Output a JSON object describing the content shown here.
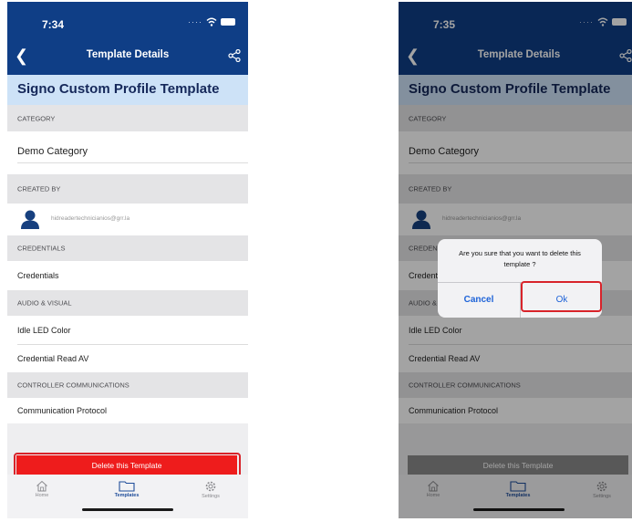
{
  "left": {
    "status": {
      "time": "7:34"
    },
    "nav": {
      "title": "Template Details"
    },
    "header": {
      "title": "Signo Custom Profile Template"
    },
    "sections": {
      "category": {
        "label": "CATEGORY",
        "value": "Demo Category"
      },
      "created_by": {
        "label": "CREATED BY",
        "email": "hidreadertechnicianios@grr.la"
      },
      "credentials": {
        "label": "CREDENTIALS",
        "item": "Credentials"
      },
      "audio_visual": {
        "label": "AUDIO & VISUAL",
        "items": [
          "Idle LED Color",
          "Credential Read AV"
        ]
      },
      "controller": {
        "label": "CONTROLLER COMMUNICATIONS",
        "item": "Communication Protocol"
      }
    },
    "delete_button": {
      "label": "Delete this Template",
      "color": "#ee1c1c"
    },
    "tabs": [
      {
        "label": "Home",
        "icon": "home-icon"
      },
      {
        "label": "Templates",
        "icon": "folder-icon"
      },
      {
        "label": "Settings",
        "icon": "gear-icon"
      }
    ]
  },
  "right": {
    "status": {
      "time": "7:35"
    },
    "nav": {
      "title": "Template Details"
    },
    "header": {
      "title": "Signo Custom Profile Template"
    },
    "sections": {
      "category": {
        "label": "CATEGORY",
        "value": "Demo Category"
      },
      "created_by": {
        "label": "CREATED BY",
        "email": "hidreadertechnicianios@grr.la"
      },
      "credentials": {
        "label": "CREDENTIALS",
        "item": "Credentials"
      },
      "audio_visual": {
        "label": "AUDIO & VISUAL",
        "items": [
          "Idle LED Color",
          "Credential Read AV"
        ]
      },
      "controller": {
        "label": "CONTROLLER COMMUNICATIONS",
        "item": "Communication Protocol"
      }
    },
    "delete_button": {
      "label": "Delete this Template",
      "color": "#8a8a8a"
    },
    "tabs": [
      {
        "label": "Home",
        "icon": "home-icon"
      },
      {
        "label": "Templates",
        "icon": "folder-icon"
      },
      {
        "label": "Settings",
        "icon": "gear-icon"
      }
    ],
    "dialog": {
      "message": "Are you sure that you want to delete this template ?",
      "cancel": "Cancel",
      "ok": "Ok"
    }
  },
  "colors": {
    "brand_blue": "#0f3e86",
    "header_bg": "#cde2f7",
    "highlight_red": "#d8232a",
    "dialog_action_blue": "#1e63d8"
  }
}
